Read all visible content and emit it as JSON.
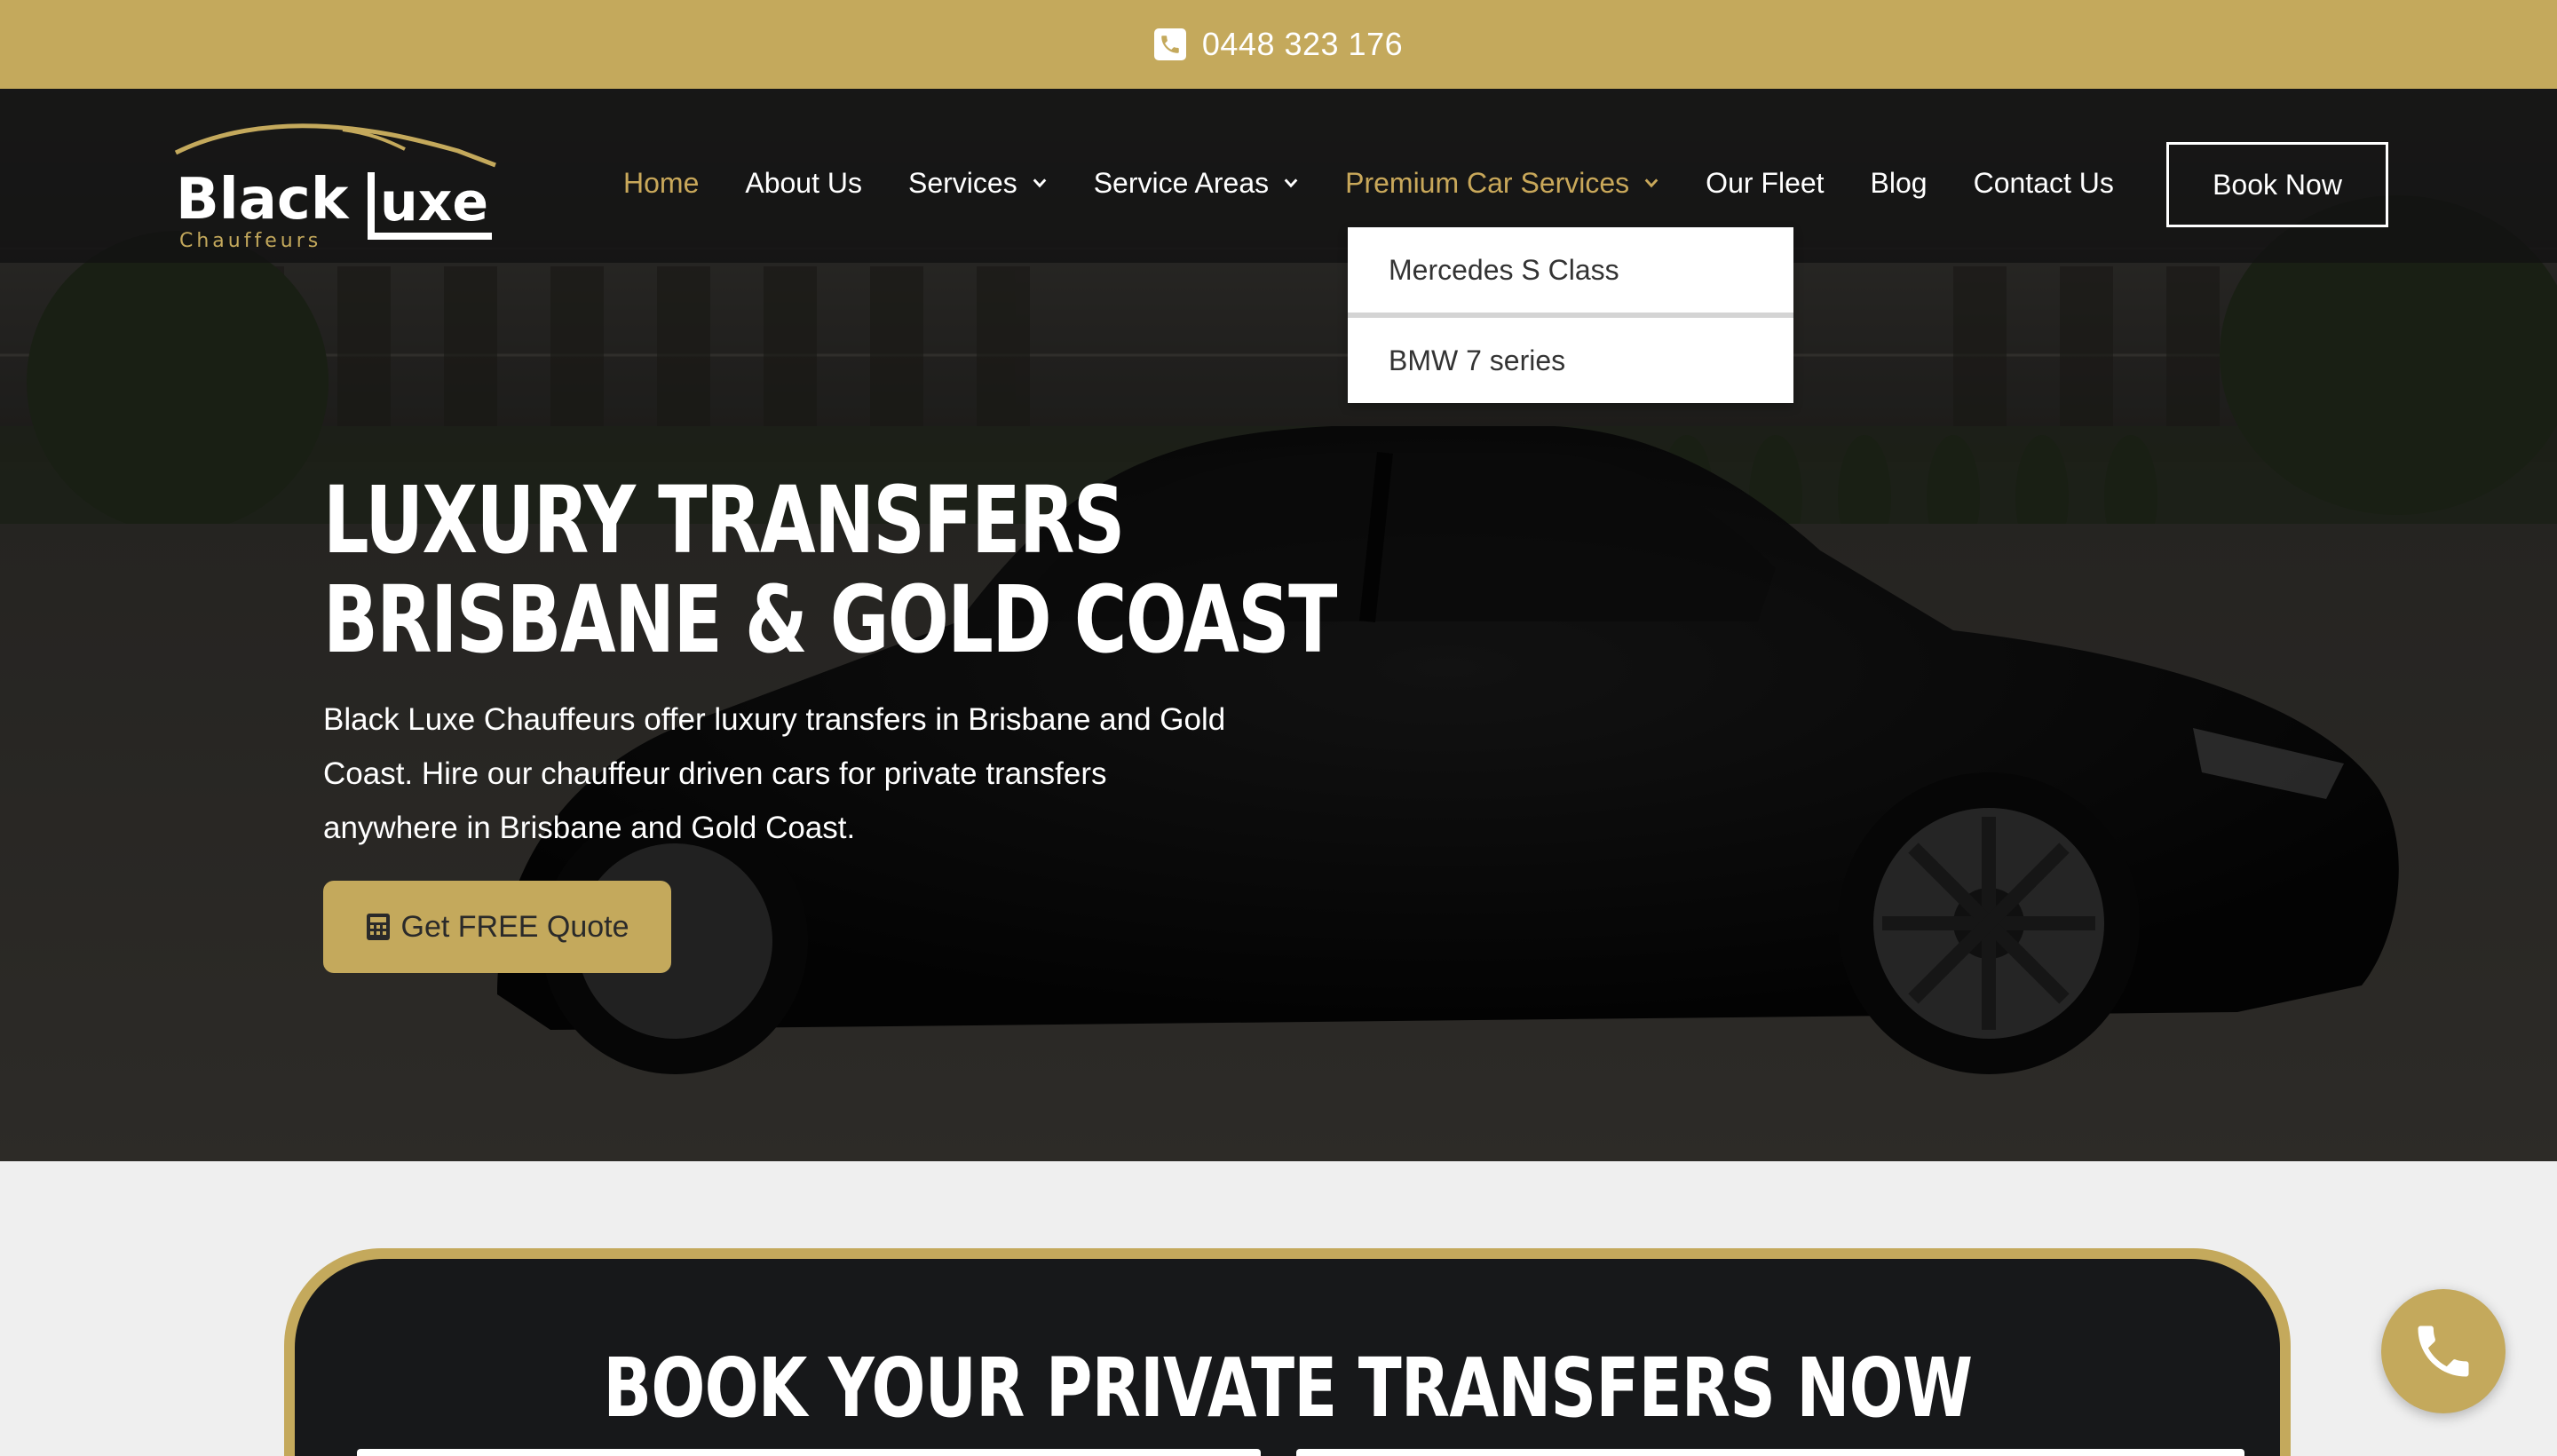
{
  "topbar": {
    "phone": "0448 323 176",
    "icon": "phone-square-icon"
  },
  "brand": {
    "logo_word_1": "Black",
    "logo_word_2": "Luxe",
    "logo_sub": "Chauffeurs"
  },
  "nav": {
    "items": [
      {
        "label": "Home",
        "active": true,
        "has_dropdown": false
      },
      {
        "label": "About Us",
        "active": false,
        "has_dropdown": false
      },
      {
        "label": "Services",
        "active": false,
        "has_dropdown": true
      },
      {
        "label": "Service Areas",
        "active": false,
        "has_dropdown": true
      },
      {
        "label": "Premium Car Services",
        "active": true,
        "has_dropdown": true
      },
      {
        "label": "Our Fleet",
        "active": false,
        "has_dropdown": false
      },
      {
        "label": "Blog",
        "active": false,
        "has_dropdown": false
      },
      {
        "label": "Contact Us",
        "active": false,
        "has_dropdown": false
      }
    ],
    "book_label": "Book Now"
  },
  "dropdown": {
    "items": [
      "Mercedes S Class",
      "BMW 7 series"
    ]
  },
  "hero": {
    "title_line_1": "LUXURY TRANSFERS",
    "title_line_2": "BRISBANE & GOLD COAST",
    "text_line_1": "Black Luxe Chauffeurs offer luxury transfers in Brisbane and Gold",
    "text_line_2": "Coast. Hire our chauffeur driven cars for private transfers",
    "text_line_3": "anywhere in Brisbane and Gold Coast.",
    "cta_label": "Get FREE Quote",
    "cta_icon": "calculator-icon"
  },
  "booking": {
    "title": "BOOK YOUR PRIVATE TRANSFERS NOW"
  },
  "floating": {
    "icon": "phone-icon"
  },
  "colors": {
    "gold": "#c4a95c",
    "dark": "#17181a",
    "nav_active": "#c9a85a"
  }
}
